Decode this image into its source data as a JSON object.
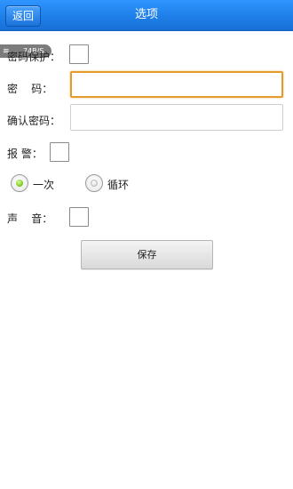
{
  "header": {
    "back_label": "返回",
    "title": "选项"
  },
  "net_badge": {
    "speed": "74B/S"
  },
  "form": {
    "password_protect_label": "密码保护：",
    "password_label": "密    码：",
    "confirm_password_label": "确认密码：",
    "alarm_label": "报 警：",
    "once_label": "一次",
    "loop_label": "循环",
    "sound_label": "声    音：",
    "save_label": "保存"
  },
  "colors": {
    "titlebar": "#1f7fe8",
    "focus_border": "#e59a2c",
    "radio_checked": "#74c51c"
  }
}
